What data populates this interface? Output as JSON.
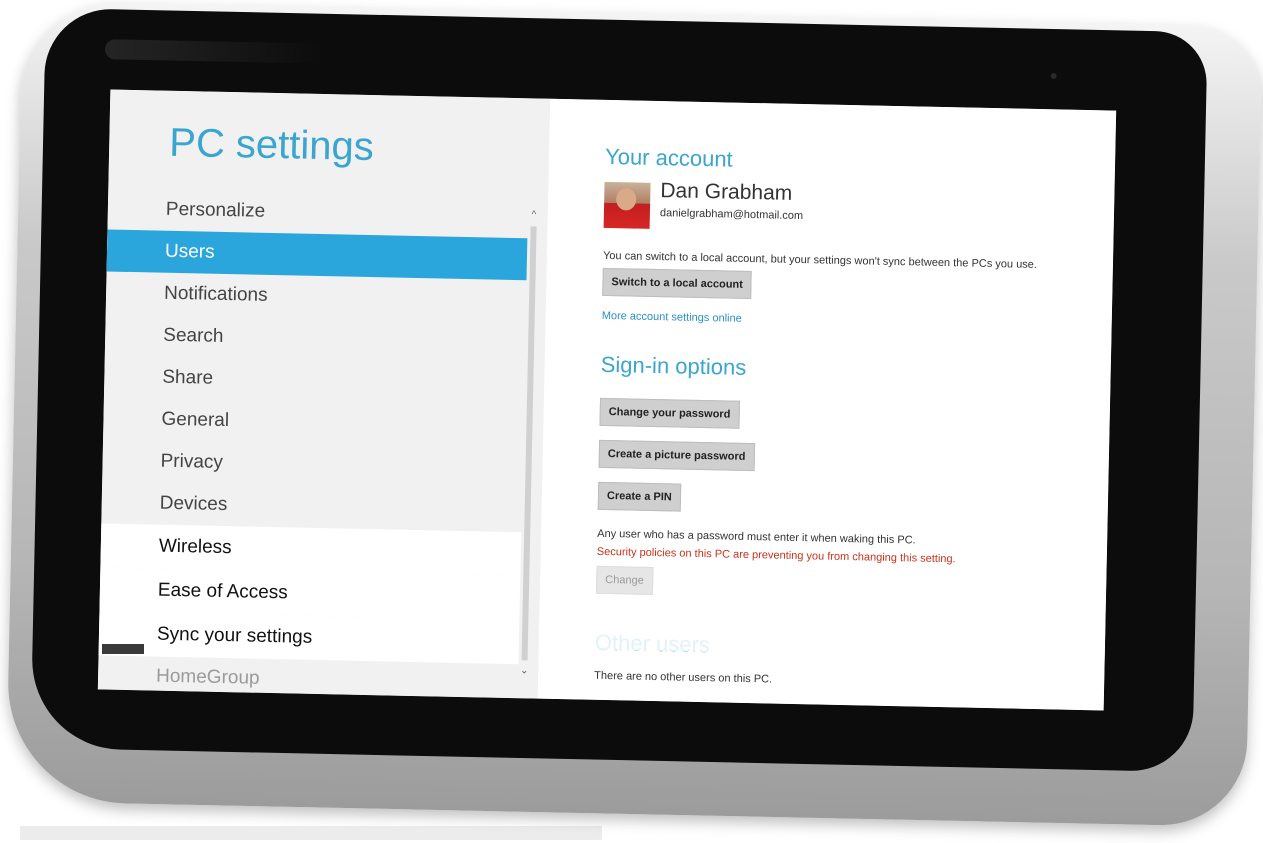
{
  "app": {
    "title": "PC settings"
  },
  "nav": {
    "items": [
      {
        "label": "Personalize"
      },
      {
        "label": "Users"
      },
      {
        "label": "Notifications"
      },
      {
        "label": "Search"
      },
      {
        "label": "Share"
      },
      {
        "label": "General"
      },
      {
        "label": "Privacy"
      },
      {
        "label": "Devices"
      },
      {
        "label": "Wireless"
      },
      {
        "label": "Ease of Access"
      },
      {
        "label": "Sync your settings"
      },
      {
        "label": "HomeGroup"
      }
    ],
    "selected": "Users"
  },
  "account": {
    "section_title": "Your account",
    "user_name": "Dan Grabham",
    "user_email": "danielgrabham@hotmail.com",
    "switch_note": "You can switch to a local account, but your settings won't sync between the PCs you use.",
    "switch_button": "Switch to a local account",
    "more_settings_link": "More account settings online"
  },
  "signin": {
    "section_title": "Sign-in options",
    "change_password_button": "Change your password",
    "picture_password_button": "Create a picture password",
    "pin_button": "Create a PIN",
    "wake_note": "Any user who has a password must enter it when waking this PC.",
    "policy_warning": "Security policies on this PC are preventing you from changing this setting.",
    "change_button": "Change"
  },
  "other_users": {
    "section_title": "Other users",
    "empty_note": "There are no other users on this PC."
  },
  "colors": {
    "accent": "#2ba6dc",
    "title": "#3aa5cf",
    "warning": "#c4341b",
    "link": "#2a8fc4"
  }
}
